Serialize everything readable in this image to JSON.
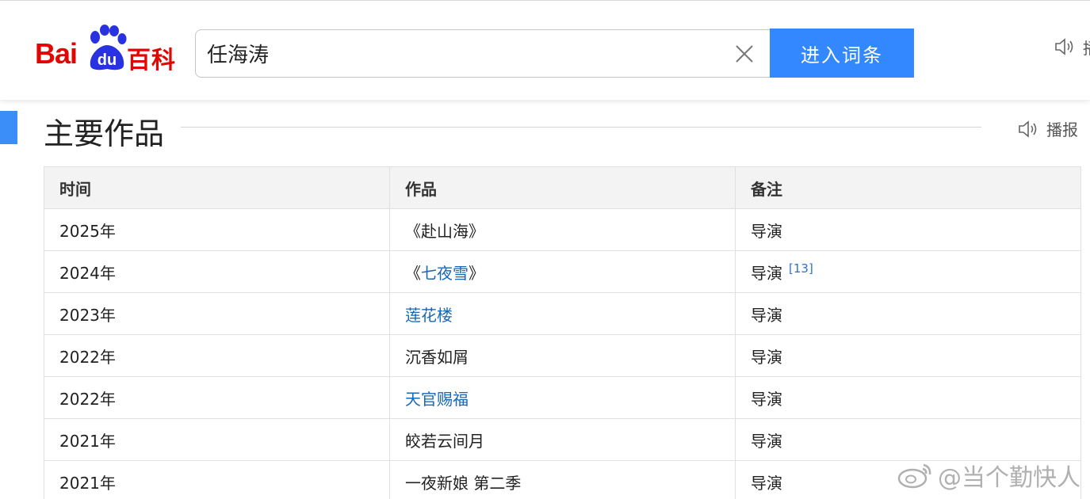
{
  "header": {
    "logo_text": "Bai",
    "logo_du": "du",
    "logo_baike": "百科",
    "search": {
      "value": "任海涛",
      "placeholder": ""
    },
    "enter_button_label": "进入词条",
    "speaker_label": "播"
  },
  "section": {
    "title": "主要作品",
    "broadcast_label": "播报"
  },
  "table": {
    "headers": [
      "时间",
      "作品",
      "备注"
    ],
    "rows": [
      {
        "year": "2025年",
        "work": "《赴山海》",
        "note": "导演",
        "ref": ""
      },
      {
        "year": "2024年",
        "work_prefix": "《",
        "work": "七夜雪",
        "work_suffix": "》",
        "note": "导演",
        "ref": "[13]"
      },
      {
        "year": "2023年",
        "work": "莲花楼",
        "note": "导演",
        "ref": ""
      },
      {
        "year": "2022年",
        "work": "沉香如屑",
        "note": "导演",
        "ref": ""
      },
      {
        "year": "2022年",
        "work": "天官赐福",
        "note": "导演",
        "ref": ""
      },
      {
        "year": "2021年",
        "work": "皎若云间月",
        "note": "导演",
        "ref": ""
      },
      {
        "year": "2021年",
        "work": "一夜新娘 第二季",
        "note": "导演",
        "ref": ""
      }
    ]
  },
  "watermark": "@当个勤快人",
  "colors": {
    "brand_red": "#e10601",
    "brand_blue": "#2932e1",
    "button_blue": "#3388ff",
    "section_bar": "#3b8ef7",
    "link": "#1867b7"
  }
}
